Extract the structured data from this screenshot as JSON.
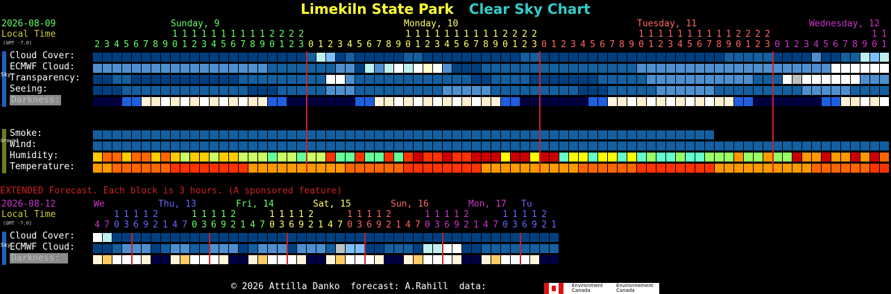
{
  "header": {
    "title": "Limekiln State Park",
    "subtitle": "Clear Sky Chart",
    "date": "2026-08-09",
    "local_time": "Local Time",
    "gmt": "(GMT -7.0)",
    "days": [
      {
        "label": "Sunday, 9",
        "color": "#66ff66"
      },
      {
        "label": "Monday, 10",
        "color": "#ffff66"
      },
      {
        "label": "Tuesday, 11",
        "color": "#ff6666"
      },
      {
        "label": "Wednesday, 12",
        "color": "#cc33cc"
      }
    ]
  },
  "sky_section": {
    "side_label": "Sky",
    "rows": [
      "Cloud Cover:",
      "ECMWF Cloud:",
      "Transparency:",
      "Seeing:",
      "Darkness:"
    ]
  },
  "ground_section": {
    "side_label": "Ground",
    "rows": [
      "Smoke:",
      "Wind:",
      "Humidity:",
      "Temperature:"
    ]
  },
  "extended": {
    "heading": "EXTENDED Forecast. Each block is 3 hours. (A sponsored feature)",
    "date": "2026-08-12",
    "local_time": "Local Time",
    "gmt": "(GMT -7.0)",
    "days": [
      {
        "label": "We",
        "color": "#cc33cc"
      },
      {
        "label": "Thu, 13",
        "color": "#6666ff"
      },
      {
        "label": "Fri, 14",
        "color": "#66ff66"
      },
      {
        "label": "Sat, 15",
        "color": "#ffff66"
      },
      {
        "label": "Sun, 16",
        "color": "#ff6666"
      },
      {
        "label": "Mon, 17",
        "color": "#cc33cc"
      },
      {
        "label": "Tu",
        "color": "#6666ff"
      }
    ],
    "side_label": "Sky",
    "rows": [
      "Cloud Cover:",
      "ECMWF Cloud:",
      "Darkness:"
    ]
  },
  "footer": {
    "copyright": "© 2026 Attilla Danko  forecast: A.Rahill  data:",
    "env_en": "Environment Canada",
    "env_fr": "Environnement Canada"
  },
  "colors": {
    "sky_dark": "#003f7f",
    "sky_mid": "#135f9f",
    "sky_light": "#4f8fcf",
    "sky_clear": "#ffffff",
    "separator": "#cc2222"
  }
}
